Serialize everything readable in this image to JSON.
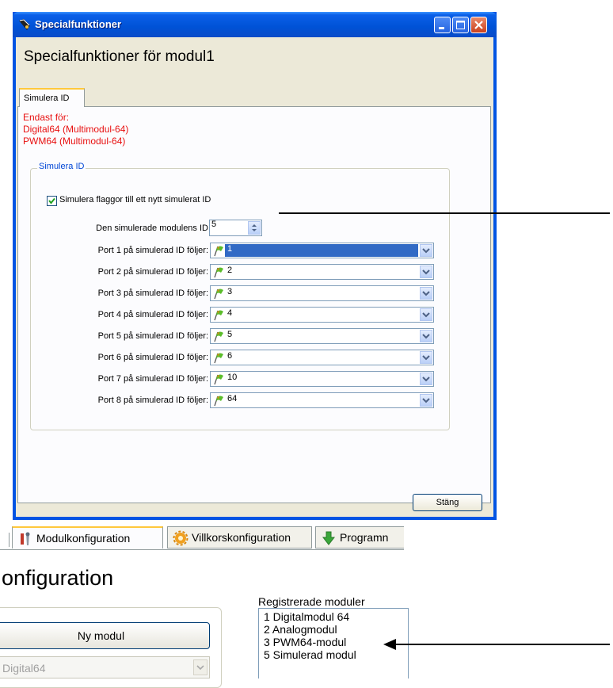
{
  "dialog": {
    "title": "Specialfunktioner",
    "heading": "Specialfunktioner för modul1",
    "tab": "Simulera ID",
    "notice": [
      "Endast för:",
      "Digital64 (Multimodul-64)",
      "PWM64 (Multimodul-64)"
    ],
    "group_title": "Simulera ID",
    "checkbox_label": "Simulera flaggor till ett nytt simulerat ID",
    "checkbox_checked": true,
    "sim_id_label": "Den simulerade modulens ID",
    "sim_id_value": "5",
    "ports": [
      {
        "label": "Port 1 på simulerad ID följer:",
        "value": "1"
      },
      {
        "label": "Port 2 på simulerad ID följer:",
        "value": "2"
      },
      {
        "label": "Port 3 på simulerad ID följer:",
        "value": "3"
      },
      {
        "label": "Port 4 på simulerad ID följer:",
        "value": "4"
      },
      {
        "label": "Port 5 på simulerad ID följer:",
        "value": "5"
      },
      {
        "label": "Port 6 på simulerad ID följer:",
        "value": "6"
      },
      {
        "label": "Port 7 på simulerad ID följer:",
        "value": "10"
      },
      {
        "label": "Port 8 på simulerad ID följer:",
        "value": "64"
      }
    ],
    "close_button": "Stäng"
  },
  "main_window": {
    "tabs": [
      "Modulkonfiguration",
      "Villkorskonfiguration",
      "Programn"
    ],
    "title": "onfiguration",
    "new_module_button": "Ny modul",
    "module_type": "Digital64",
    "registered_label": "Registrerade moduler",
    "registered_modules": [
      "1  Digitalmodul 64",
      "2  Analogmodul",
      "3  PWM64-modul",
      "5  Simulerad modul"
    ]
  },
  "colors": {
    "titlebar": "#0054e3",
    "dialog_bg": "#ece9d8",
    "notice_text": "#e81010",
    "group_title": "#0046d5",
    "selection": "#316ac5"
  }
}
